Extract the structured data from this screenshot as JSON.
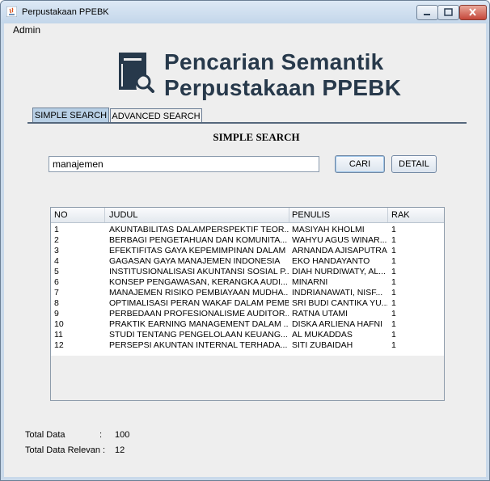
{
  "window": {
    "title": "Perpustakaan PPEBK"
  },
  "menu": {
    "items": [
      "Admin"
    ]
  },
  "logo": {
    "line1": "Pencarian Semantik",
    "line2": "Perpustakaan PPEBK"
  },
  "tabs": [
    {
      "label": "SIMPLE SEARCH",
      "active": true
    },
    {
      "label": "ADVANCED SEARCH",
      "active": false
    }
  ],
  "search": {
    "title": "SIMPLE SEARCH",
    "query": "manajemen",
    "cari_label": "CARI",
    "detail_label": "DETAIL"
  },
  "table": {
    "columns": [
      "NO",
      "JUDUL",
      "PENULIS",
      "RAK"
    ],
    "rows": [
      [
        "1",
        "AKUNTABILITAS DALAMPERSPEKTIF TEOR...",
        "MASIYAH KHOLMI",
        "1"
      ],
      [
        "2",
        "BERBAGI PENGETAHUAN DAN KOMUNITA...",
        "WAHYU AGUS WINAR...",
        "1"
      ],
      [
        "3",
        "EFEKTIFITAS GAYA KEPEMIMPINAN DALAM ...",
        "ARNANDA AJISAPUTRA",
        "1"
      ],
      [
        "4",
        "GAGASAN GAYA MANAJEMEN INDONESIA",
        "EKO HANDAYANTO",
        "1"
      ],
      [
        "5",
        "INSTITUSIONALISASI AKUNTANSI SOSIAL P...",
        "DIAH NURDIWATY, AL...",
        "1"
      ],
      [
        "6",
        "KONSEP PENGAWASAN, KERANGKA AUDI...",
        "MINARNI",
        "1"
      ],
      [
        "7",
        "MANAJEMEN RISIKO PEMBIAYAAN MUDHA...",
        "INDRIANAWATI, NISF...",
        "1"
      ],
      [
        "8",
        "OPTIMALISASI PERAN WAKAF DALAM PEMB...",
        "SRI BUDI CANTIKA YU...",
        "1"
      ],
      [
        "9",
        "PERBEDAAN PROFESIONALISME AUDITOR...",
        "RATNA UTAMI",
        "1"
      ],
      [
        "10",
        "PRAKTIK  EARNING MANAGEMENT DALAM ...",
        "DISKA ARLIENA HAFNI",
        "1"
      ],
      [
        "11",
        "STUDI TENTANG PENGELOLAAN KEUANG...",
        "AL MUKADDAS",
        "1"
      ],
      [
        "12",
        "PERSEPSI AKUNTAN INTERNAL TERHADA...",
        "SITI ZUBAIDAH",
        "1"
      ]
    ]
  },
  "summary": {
    "total_label": "Total Data",
    "total_sep": ":",
    "total_value": "100",
    "relevan_label": "Total Data Relevan :",
    "relevan_value": "12"
  },
  "colors": {
    "accent": "#27394b",
    "tab_active": "#b8cfe5",
    "row_alt": "#eaf0f7"
  }
}
